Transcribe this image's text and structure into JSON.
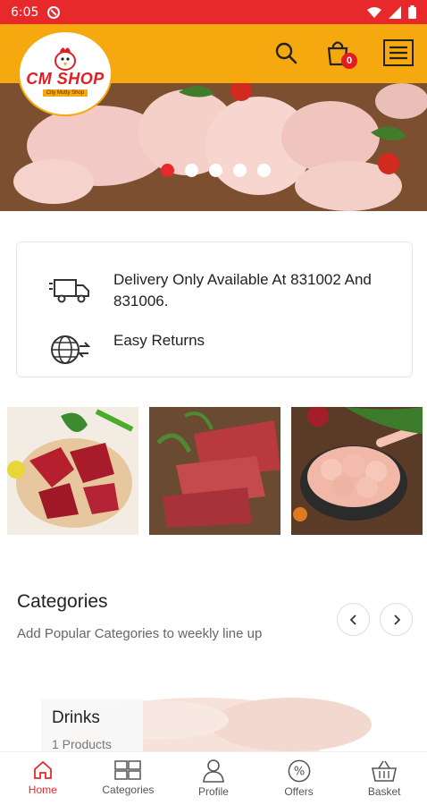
{
  "status_bar": {
    "time": "6:05"
  },
  "header": {
    "logo_text": "CM SHOP",
    "logo_tagline": "City Mutty Shop",
    "cart_count": "0"
  },
  "banner": {
    "slides": 5,
    "active_slide": 1
  },
  "info": [
    {
      "icon": "delivery-truck-icon",
      "text": "Delivery Only Available At 831002 And 831006."
    },
    {
      "icon": "globe-exchange-icon",
      "text": "Easy Returns"
    }
  ],
  "categories": {
    "title": "Categories",
    "subtitle": "Add Popular Categories to weekly line up",
    "items": [
      {
        "name": "Drinks",
        "count": "1 Products"
      }
    ]
  },
  "bottom_nav": [
    {
      "label": "Home",
      "icon": "home-icon",
      "active": true
    },
    {
      "label": "Categories",
      "icon": "grid-icon"
    },
    {
      "label": "Profile",
      "icon": "person-icon"
    },
    {
      "label": "Offers",
      "icon": "percent-icon"
    },
    {
      "label": "Basket",
      "icon": "basket-icon"
    }
  ],
  "colors": {
    "status": "#e8292b",
    "header": "#f5a90e",
    "accent": "#e8292b"
  }
}
